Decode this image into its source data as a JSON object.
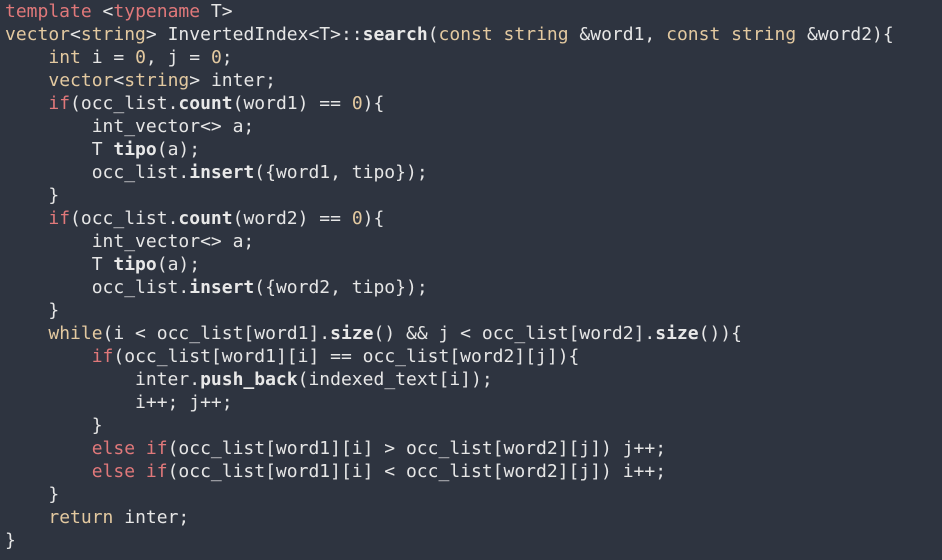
{
  "colors": {
    "background": "#2e3440",
    "plain": "#e6e6e6",
    "keyword": "#e0787a",
    "type": "#e3c9a0",
    "number": "#e3c9a0",
    "function": "#e8e8e8"
  },
  "code_lines": [
    [
      {
        "t": "kw",
        "v": "template"
      },
      {
        "t": "plain",
        "v": " "
      },
      {
        "t": "plain",
        "v": "<"
      },
      {
        "t": "kw",
        "v": "typename"
      },
      {
        "t": "plain",
        "v": " T>"
      }
    ],
    [
      {
        "t": "type",
        "v": "vector"
      },
      {
        "t": "plain",
        "v": "<"
      },
      {
        "t": "type",
        "v": "string"
      },
      {
        "t": "plain",
        "v": "> InvertedIndex<T>::"
      },
      {
        "t": "fn",
        "v": "search"
      },
      {
        "t": "plain",
        "v": "("
      },
      {
        "t": "type",
        "v": "const string"
      },
      {
        "t": "plain",
        "v": " &word1, "
      },
      {
        "t": "type",
        "v": "const string"
      },
      {
        "t": "plain",
        "v": " &word2){"
      }
    ],
    [
      {
        "t": "plain",
        "v": "    "
      },
      {
        "t": "type",
        "v": "int"
      },
      {
        "t": "plain",
        "v": " i = "
      },
      {
        "t": "num",
        "v": "0"
      },
      {
        "t": "plain",
        "v": ", j = "
      },
      {
        "t": "num",
        "v": "0"
      },
      {
        "t": "plain",
        "v": ";"
      }
    ],
    [
      {
        "t": "plain",
        "v": "    "
      },
      {
        "t": "type",
        "v": "vector"
      },
      {
        "t": "plain",
        "v": "<"
      },
      {
        "t": "type",
        "v": "string"
      },
      {
        "t": "plain",
        "v": "> inter;"
      }
    ],
    [
      {
        "t": "plain",
        "v": "    "
      },
      {
        "t": "kw",
        "v": "if"
      },
      {
        "t": "plain",
        "v": "(occ_list."
      },
      {
        "t": "fn",
        "v": "count"
      },
      {
        "t": "plain",
        "v": "(word1) == "
      },
      {
        "t": "num",
        "v": "0"
      },
      {
        "t": "plain",
        "v": "){"
      }
    ],
    [
      {
        "t": "plain",
        "v": "        int_vector<> a;"
      }
    ],
    [
      {
        "t": "plain",
        "v": "        T "
      },
      {
        "t": "fn",
        "v": "tipo"
      },
      {
        "t": "plain",
        "v": "(a);"
      }
    ],
    [
      {
        "t": "plain",
        "v": "        occ_list."
      },
      {
        "t": "fn",
        "v": "insert"
      },
      {
        "t": "plain",
        "v": "({word1, tipo});"
      }
    ],
    [
      {
        "t": "plain",
        "v": "    }"
      }
    ],
    [
      {
        "t": "plain",
        "v": "    "
      },
      {
        "t": "kw",
        "v": "if"
      },
      {
        "t": "plain",
        "v": "(occ_list."
      },
      {
        "t": "fn",
        "v": "count"
      },
      {
        "t": "plain",
        "v": "(word2) == "
      },
      {
        "t": "num",
        "v": "0"
      },
      {
        "t": "plain",
        "v": "){"
      }
    ],
    [
      {
        "t": "plain",
        "v": "        int_vector<> a;"
      }
    ],
    [
      {
        "t": "plain",
        "v": "        T "
      },
      {
        "t": "fn",
        "v": "tipo"
      },
      {
        "t": "plain",
        "v": "(a);"
      }
    ],
    [
      {
        "t": "plain",
        "v": "        occ_list."
      },
      {
        "t": "fn",
        "v": "insert"
      },
      {
        "t": "plain",
        "v": "({word2, tipo});"
      }
    ],
    [
      {
        "t": "plain",
        "v": "    }"
      }
    ],
    [
      {
        "t": "plain",
        "v": "    "
      },
      {
        "t": "type",
        "v": "while"
      },
      {
        "t": "plain",
        "v": "(i < occ_list[word1]."
      },
      {
        "t": "fn",
        "v": "size"
      },
      {
        "t": "plain",
        "v": "() && j < occ_list[word2]."
      },
      {
        "t": "fn",
        "v": "size"
      },
      {
        "t": "plain",
        "v": "()){"
      }
    ],
    [
      {
        "t": "plain",
        "v": "        "
      },
      {
        "t": "kw",
        "v": "if"
      },
      {
        "t": "plain",
        "v": "(occ_list[word1][i] == occ_list[word2][j]){"
      }
    ],
    [
      {
        "t": "plain",
        "v": "            inter."
      },
      {
        "t": "fn",
        "v": "push_back"
      },
      {
        "t": "plain",
        "v": "(indexed_text[i]);"
      }
    ],
    [
      {
        "t": "plain",
        "v": "            i++; j++;"
      }
    ],
    [
      {
        "t": "plain",
        "v": "        }"
      }
    ],
    [
      {
        "t": "plain",
        "v": "        "
      },
      {
        "t": "kw",
        "v": "else if"
      },
      {
        "t": "plain",
        "v": "(occ_list[word1][i] > occ_list[word2][j]) j++;"
      }
    ],
    [
      {
        "t": "plain",
        "v": "        "
      },
      {
        "t": "kw",
        "v": "else if"
      },
      {
        "t": "plain",
        "v": "(occ_list[word1][i] < occ_list[word2][j]) i++;"
      }
    ],
    [
      {
        "t": "plain",
        "v": "    }"
      }
    ],
    [
      {
        "t": "plain",
        "v": "    "
      },
      {
        "t": "type",
        "v": "return"
      },
      {
        "t": "plain",
        "v": " inter;"
      }
    ],
    [
      {
        "t": "plain",
        "v": "}"
      }
    ]
  ]
}
